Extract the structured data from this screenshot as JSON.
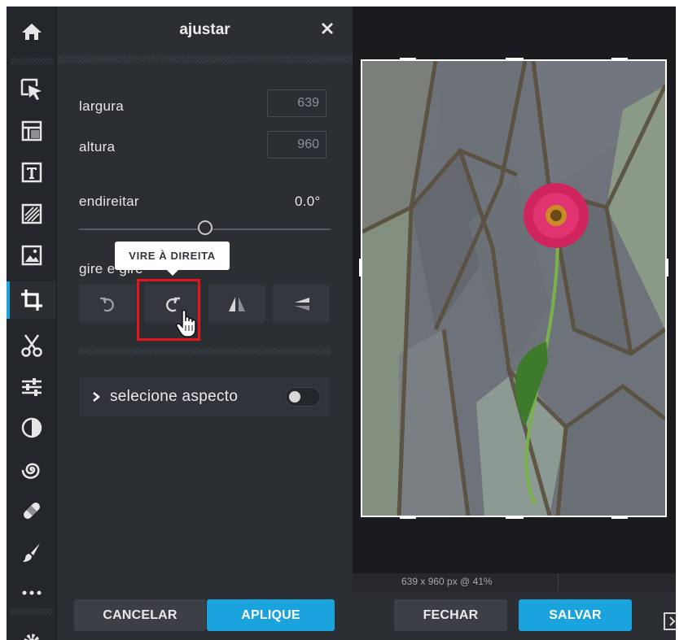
{
  "panel": {
    "title": "ajustar",
    "width_label": "largura",
    "width_value": "639",
    "height_label": "altura",
    "height_value": "960",
    "straighten_label": "endireitar",
    "straighten_value": "0.0°",
    "straighten_level": 0.5,
    "rotate_label": "gire e gire",
    "tooltip": "VIRE À DIREITA",
    "aspect_label": "selecione aspecto",
    "cancel_label": "CANCELAR",
    "apply_label": "APLIQUE"
  },
  "rail": {
    "items": [
      "home-icon",
      "select-icon",
      "layout-icon",
      "text-icon",
      "texture-icon",
      "image-icon",
      "crop-icon",
      "cut-icon",
      "adjust-icon",
      "contrast-icon",
      "swirl-icon",
      "bandage-icon",
      "brush-icon",
      "more-icon",
      "settings-icon"
    ],
    "active": "crop-icon"
  },
  "canvas": {
    "status": "639 x 960 px @ 41%",
    "close_label": "FECHAR",
    "save_label": "SALVAR"
  },
  "colors": {
    "accent": "#1aa3dd",
    "highlight": "#e6151b",
    "panel_bg": "#2b2e33",
    "rail_bg": "#23262a"
  }
}
